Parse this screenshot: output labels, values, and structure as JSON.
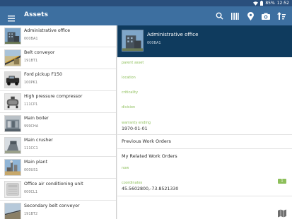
{
  "status": {
    "battery": "85%",
    "time": "12:52"
  },
  "app": {
    "title": "Assets"
  },
  "list": [
    {
      "name": "Administrative office",
      "code": "000BA1"
    },
    {
      "name": "Belt conveyor",
      "code": "191BT1"
    },
    {
      "name": "Ford pickup F150",
      "code": "100PK1"
    },
    {
      "name": "High pressure compressor",
      "code": "111CP1"
    },
    {
      "name": "Main boiler",
      "code": "999CHA"
    },
    {
      "name": "Main crusher",
      "code": "111CC1"
    },
    {
      "name": "Main plant",
      "code": "000US1"
    },
    {
      "name": "Office air conditioning unit",
      "code": "000CL1"
    },
    {
      "name": "Secondary belt conveyor",
      "code": "191BT2"
    }
  ],
  "detail": {
    "title": "Administrative office",
    "code": "000BA1",
    "fields": {
      "parent_asset": "parent asset",
      "location": "location",
      "criticality": "criticality",
      "division": "division",
      "warranty_label": "warranty ending",
      "warranty_value": "1970-01-01",
      "previous_work_orders": "Previous Work Orders",
      "my_related_work_orders": "My Related Work Orders",
      "related_count": "1",
      "now": "now",
      "coordinates_label": "coordinates",
      "coordinates_value": "45.5602800,-73.8521330"
    }
  },
  "colors": {
    "status_bar": "#2a4f7c",
    "app_bar": "#3d6fa0",
    "detail_header": "#0f3b5e",
    "accent_green": "#8dbf5a"
  }
}
